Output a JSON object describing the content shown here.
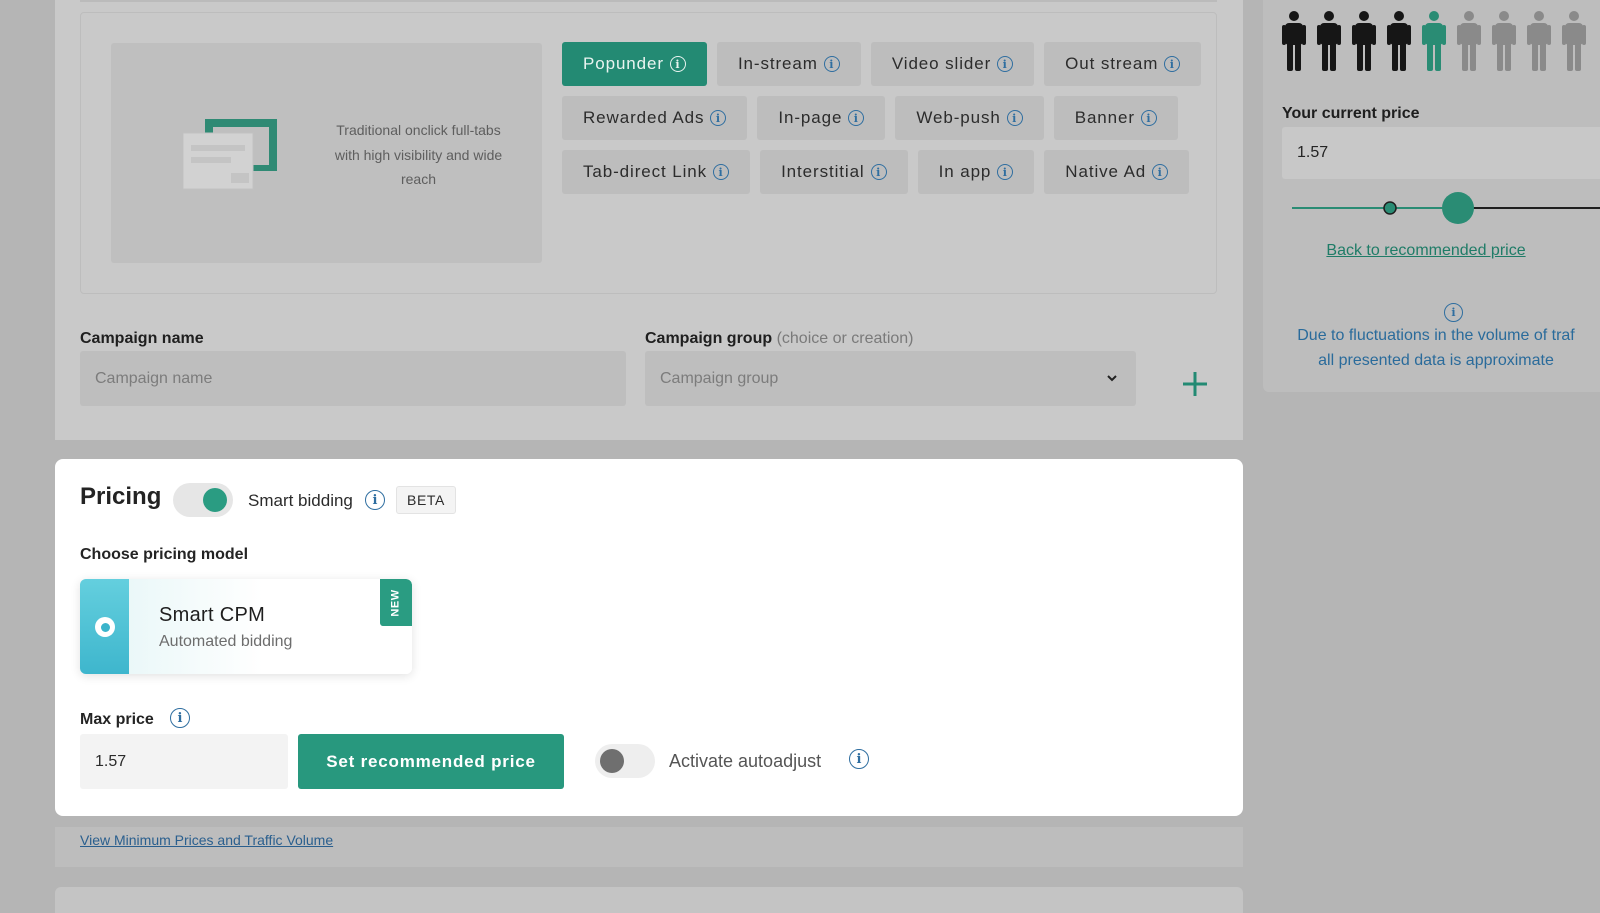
{
  "format": {
    "preview_description": "Traditional onclick full-tabs with high visibility and wide reach",
    "tags": [
      {
        "label": "Popunder",
        "active": true
      },
      {
        "label": "In-stream",
        "active": false
      },
      {
        "label": "Video slider",
        "active": false
      },
      {
        "label": "Out stream",
        "active": false
      },
      {
        "label": "Rewarded Ads",
        "active": false
      },
      {
        "label": "In-page",
        "active": false
      },
      {
        "label": "Web-push",
        "active": false
      },
      {
        "label": "Banner",
        "active": false
      },
      {
        "label": "Tab-direct Link",
        "active": false
      },
      {
        "label": "Interstitial",
        "active": false
      },
      {
        "label": "In app",
        "active": false
      },
      {
        "label": "Native Ad",
        "active": false
      }
    ]
  },
  "campaign": {
    "name_label": "Campaign name",
    "name_placeholder": "Campaign name",
    "group_label": "Campaign group",
    "group_hint": "(choice or creation)",
    "group_placeholder": "Campaign group"
  },
  "estimate": {
    "people_total": 9,
    "people_dark": 4,
    "people_highlight_index": 4,
    "current_price_label": "Your current price",
    "current_price_value": "1.57",
    "back_link": "Back to recommended price",
    "note_line1": "Due to fluctuations in the volume of traf",
    "note_line2": "all presented data is approximate"
  },
  "pricing": {
    "title": "Pricing",
    "smart_bidding_label": "Smart bidding",
    "smart_bidding_on": true,
    "beta_badge": "BETA",
    "model_label": "Choose pricing model",
    "model": {
      "name": "Smart CPM",
      "subtitle": "Automated bidding",
      "badge": "NEW"
    },
    "max_price_label": "Max price",
    "max_price_value": "1.57",
    "set_recommended_button": "Set recommended price",
    "autoadjust_label": "Activate autoadjust",
    "autoadjust_on": false
  },
  "links": {
    "min_prices": "View Minimum Prices and Traffic Volume"
  },
  "colors": {
    "accent": "#28987e",
    "link": "#2a5f8e"
  }
}
